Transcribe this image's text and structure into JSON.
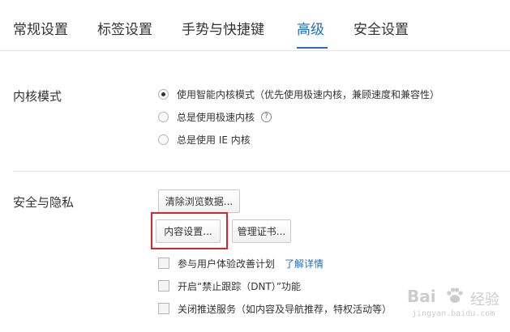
{
  "tabs": [
    {
      "label": "常规设置",
      "active": false
    },
    {
      "label": "标签设置",
      "active": false
    },
    {
      "label": "手势与快捷键",
      "active": false
    },
    {
      "label": "高级",
      "active": true
    },
    {
      "label": "安全设置",
      "active": false
    }
  ],
  "kernel": {
    "title": "内核模式",
    "options": [
      {
        "label": "使用智能内核模式（优先使用极速内核，兼顾速度和兼容性）",
        "checked": true
      },
      {
        "label": "总是使用极速内核",
        "checked": false,
        "help": "?"
      },
      {
        "label": "总是使用 IE 内核",
        "checked": false
      }
    ]
  },
  "security": {
    "title": "安全与隐私",
    "clear_data_button": "清除浏览数据...",
    "content_settings_button": "内容设置...",
    "manage_certs_button": "管理证书...",
    "checkboxes": [
      {
        "label": "参与用户体验改善计划",
        "link": "了解详情",
        "checked": false
      },
      {
        "label": "开启“禁止跟踪（DNT）”功能",
        "checked": false
      },
      {
        "label": "关闭推送服务（如内容及导航推荐，特权活动等）",
        "checked": false
      }
    ]
  },
  "watermark": {
    "logo_text": "Bai",
    "brand_cn": "经验",
    "url": "jingyan.baidu.com"
  },
  "colors": {
    "accent": "#1f6fbf",
    "highlight": "#d6262c"
  }
}
